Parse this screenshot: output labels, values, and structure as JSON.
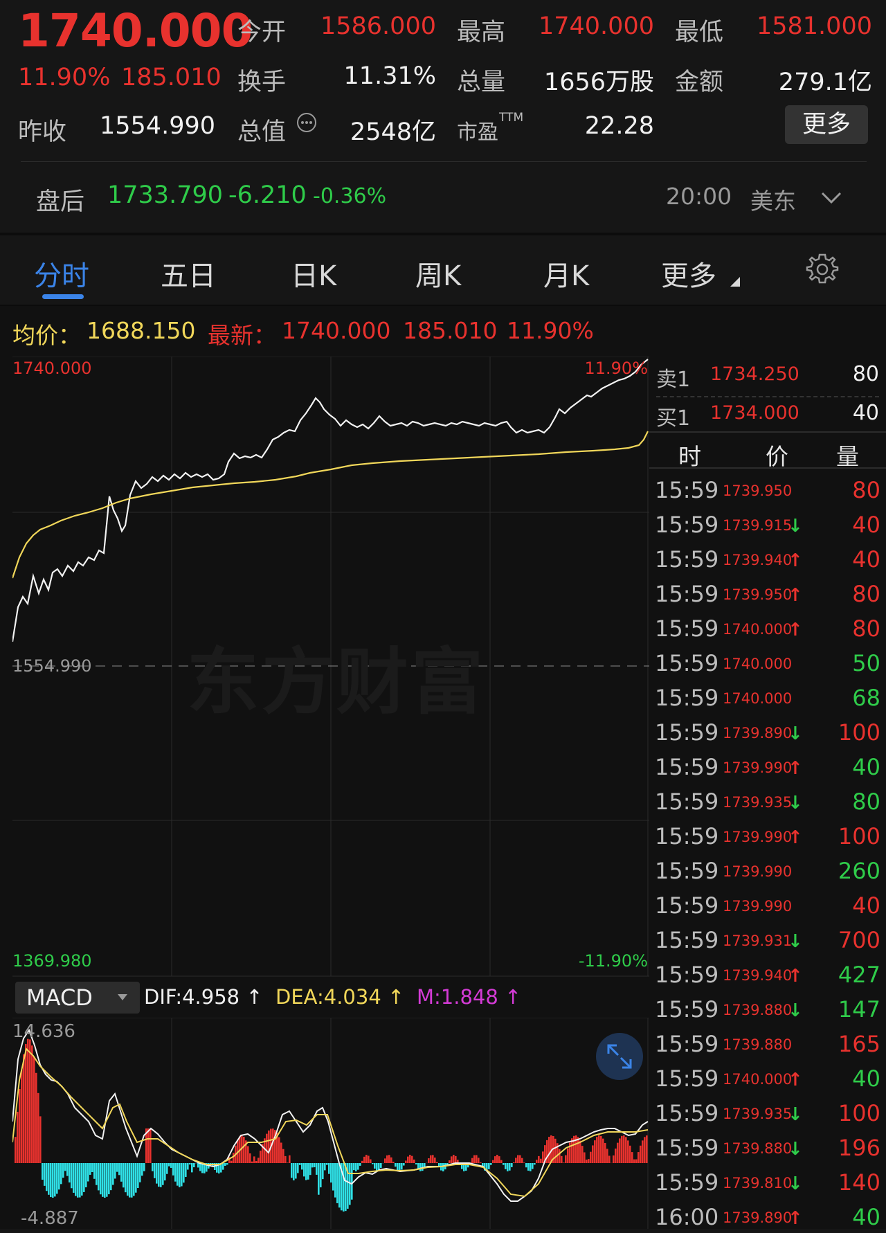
{
  "quote": {
    "price": "1740.000",
    "change_pct": "11.90%",
    "change": "185.010",
    "open_label": "今开",
    "open": "1586.000",
    "high_label": "最高",
    "high": "1740.000",
    "low_label": "最低",
    "low": "1581.000",
    "turnover_label": "换手",
    "turnover": "11.31%",
    "volume_label": "总量",
    "volume": "1656万股",
    "amount_label": "金额",
    "amount": "279.1亿",
    "prev_close_label": "昨收",
    "prev_close": "1554.990",
    "mktcap_label": "总值",
    "mktcap": "2548亿",
    "pe_label": "市盈",
    "pe_sup": "TTM",
    "pe": "22.28",
    "more_label": "更多"
  },
  "after_hours": {
    "label": "盘后",
    "price": "1733.790",
    "change": "-6.210",
    "pct": "-0.36%",
    "time": "20:00",
    "zone": "美东"
  },
  "tabs": [
    {
      "label": "分时",
      "active": true
    },
    {
      "label": "五日"
    },
    {
      "label": "日K"
    },
    {
      "label": "周K"
    },
    {
      "label": "月K"
    },
    {
      "label": "更多"
    }
  ],
  "info": {
    "avg_label": "均价：",
    "avg": "1688.150",
    "latest_label": "最新：",
    "latest": "1740.000",
    "latest_change": "185.010",
    "latest_pct": "11.90%"
  },
  "axis": {
    "top_price": "1740.000",
    "top_pct": "11.90%",
    "mid_price": "1554.990",
    "bottom_price": "1369.980",
    "bottom_pct": "-11.90%"
  },
  "watermark": "东方财富",
  "orderbook": [
    {
      "label": "卖1",
      "price": "1734.250",
      "qty": "80"
    },
    {
      "label": "买1",
      "price": "1734.000",
      "qty": "40"
    }
  ],
  "trades_header": {
    "time": "时",
    "price": "价",
    "qty": "量"
  },
  "trades": [
    {
      "time": "15:59",
      "price": "1739.950",
      "arrow": "",
      "qty": "80",
      "side": "red"
    },
    {
      "time": "15:59",
      "price": "1739.915",
      "arrow": "↓",
      "qty": "40",
      "side": "red"
    },
    {
      "time": "15:59",
      "price": "1739.940",
      "arrow": "↑",
      "qty": "40",
      "side": "red"
    },
    {
      "time": "15:59",
      "price": "1739.950",
      "arrow": "↑",
      "qty": "80",
      "side": "red"
    },
    {
      "time": "15:59",
      "price": "1740.000",
      "arrow": "↑",
      "qty": "80",
      "side": "red"
    },
    {
      "time": "15:59",
      "price": "1740.000",
      "arrow": "",
      "qty": "50",
      "side": "green"
    },
    {
      "time": "15:59",
      "price": "1740.000",
      "arrow": "",
      "qty": "68",
      "side": "green"
    },
    {
      "time": "15:59",
      "price": "1739.890",
      "arrow": "↓",
      "qty": "100",
      "side": "red"
    },
    {
      "time": "15:59",
      "price": "1739.990",
      "arrow": "↑",
      "qty": "40",
      "side": "green"
    },
    {
      "time": "15:59",
      "price": "1739.935",
      "arrow": "↓",
      "qty": "80",
      "side": "green"
    },
    {
      "time": "15:59",
      "price": "1739.990",
      "arrow": "↑",
      "qty": "100",
      "side": "red"
    },
    {
      "time": "15:59",
      "price": "1739.990",
      "arrow": "",
      "qty": "260",
      "side": "green"
    },
    {
      "time": "15:59",
      "price": "1739.990",
      "arrow": "",
      "qty": "40",
      "side": "red"
    },
    {
      "time": "15:59",
      "price": "1739.931",
      "arrow": "↓",
      "qty": "700",
      "side": "red"
    },
    {
      "time": "15:59",
      "price": "1739.940",
      "arrow": "↑",
      "qty": "427",
      "side": "green"
    },
    {
      "time": "15:59",
      "price": "1739.880",
      "arrow": "↓",
      "qty": "147",
      "side": "green"
    },
    {
      "time": "15:59",
      "price": "1739.880",
      "arrow": "",
      "qty": "165",
      "side": "red"
    },
    {
      "time": "15:59",
      "price": "1740.000",
      "arrow": "↑",
      "qty": "40",
      "side": "green"
    },
    {
      "time": "15:59",
      "price": "1739.935",
      "arrow": "↓",
      "qty": "100",
      "side": "red"
    },
    {
      "time": "15:59",
      "price": "1739.880",
      "arrow": "↓",
      "qty": "196",
      "side": "red"
    },
    {
      "time": "15:59",
      "price": "1739.810",
      "arrow": "↓",
      "qty": "140",
      "side": "red"
    },
    {
      "time": "16:00",
      "price": "1739.890",
      "arrow": "↑",
      "qty": "40",
      "side": "green"
    }
  ],
  "macd": {
    "selector": "MACD",
    "dif": "DIF:4.958 ↑",
    "dea": "DEA:4.034 ↑",
    "m": "M:1.848 ↑",
    "top": "14.636",
    "bottom": "-4.887"
  },
  "colors": {
    "up": "#e8322e",
    "down": "#2fcc4a",
    "avg_line": "#f1d75a",
    "accent": "#3b84e8",
    "macd_neg": "#2fe0e6",
    "macd_m": "#d43bd6"
  },
  "icons": [
    "info-circle-icon",
    "chevron-down-icon",
    "gear-icon",
    "caret-down-icon",
    "expand-icon"
  ]
}
